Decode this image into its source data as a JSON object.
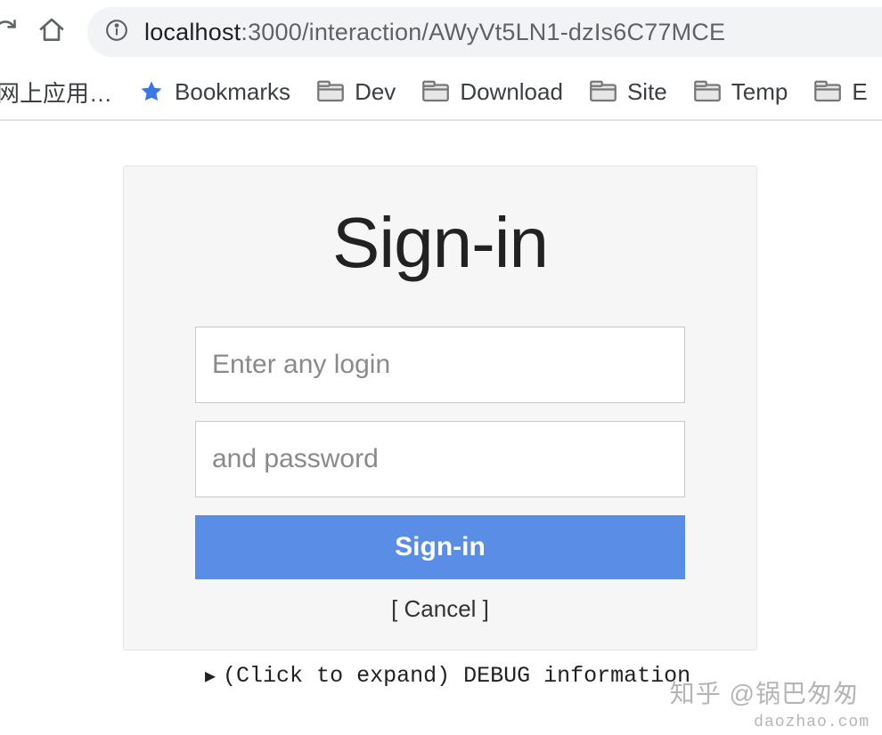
{
  "browser": {
    "url_host": "localhost",
    "url_rest": ":3000/interaction/AWyVt5LN1-dzIs6C77MCE"
  },
  "bookmarks": {
    "items": [
      {
        "label": "网上应用…",
        "icon": "none"
      },
      {
        "label": "Bookmarks",
        "icon": "star"
      },
      {
        "label": "Dev",
        "icon": "folder"
      },
      {
        "label": "Download",
        "icon": "folder"
      },
      {
        "label": "Site",
        "icon": "folder"
      },
      {
        "label": "Temp",
        "icon": "folder"
      },
      {
        "label": "E",
        "icon": "folder"
      }
    ]
  },
  "form": {
    "title": "Sign-in",
    "login_placeholder": "Enter any login",
    "password_placeholder": "and password",
    "login_value": "",
    "password_value": "",
    "submit_label": "Sign-in",
    "cancel_label": "[ Cancel ]"
  },
  "debug": {
    "label": "(Click to expand) DEBUG information"
  },
  "watermark": {
    "text1": "知乎 @锅巴匆匆",
    "text2": "daozhao.com"
  }
}
